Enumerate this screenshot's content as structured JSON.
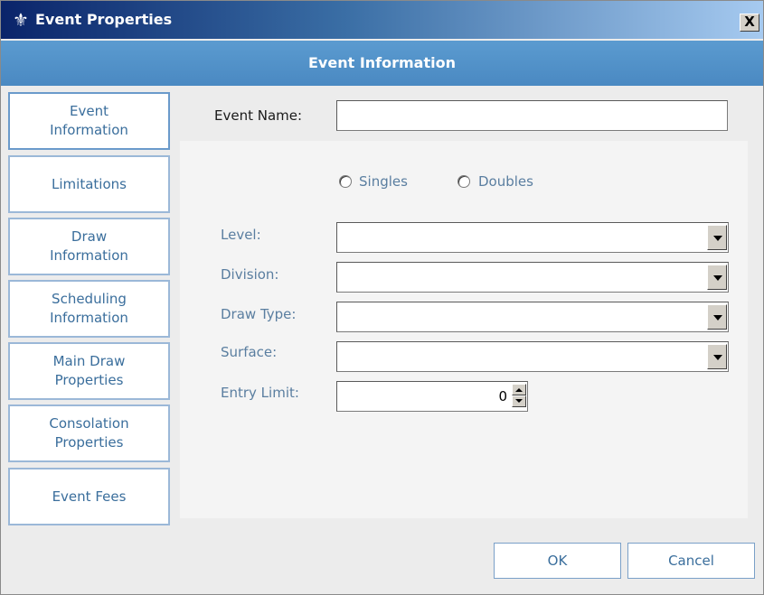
{
  "window": {
    "title": "Event Properties",
    "close_label": "X"
  },
  "section": {
    "title": "Event Information"
  },
  "nav": {
    "items": [
      {
        "label": "Event\nInformation",
        "active": true
      },
      {
        "label": "Limitations"
      },
      {
        "label": "Draw\nInformation"
      },
      {
        "label": "Scheduling\nInformation"
      },
      {
        "label": "Main Draw\nProperties"
      },
      {
        "label": "Consolation\nProperties"
      },
      {
        "label": "Event Fees"
      }
    ]
  },
  "form": {
    "event_name_label": "Event Name:",
    "event_name_value": "",
    "radio_singles_label": "Singles",
    "radio_doubles_label": "Doubles",
    "level_label": "Level:",
    "level_value": "",
    "division_label": "Division:",
    "division_value": "",
    "draw_type_label": "Draw Type:",
    "draw_type_value": "",
    "surface_label": "Surface:",
    "surface_value": "",
    "entry_limit_label": "Entry Limit:",
    "entry_limit_value": "0"
  },
  "buttons": {
    "ok_label": "OK",
    "cancel_label": "Cancel"
  },
  "colors": {
    "title_bar": "#0a246a",
    "section_bar": "#4a89c2",
    "accent_text": "#3a6e9c"
  },
  "icons": {
    "title_icon": "tennis-player-icon"
  }
}
